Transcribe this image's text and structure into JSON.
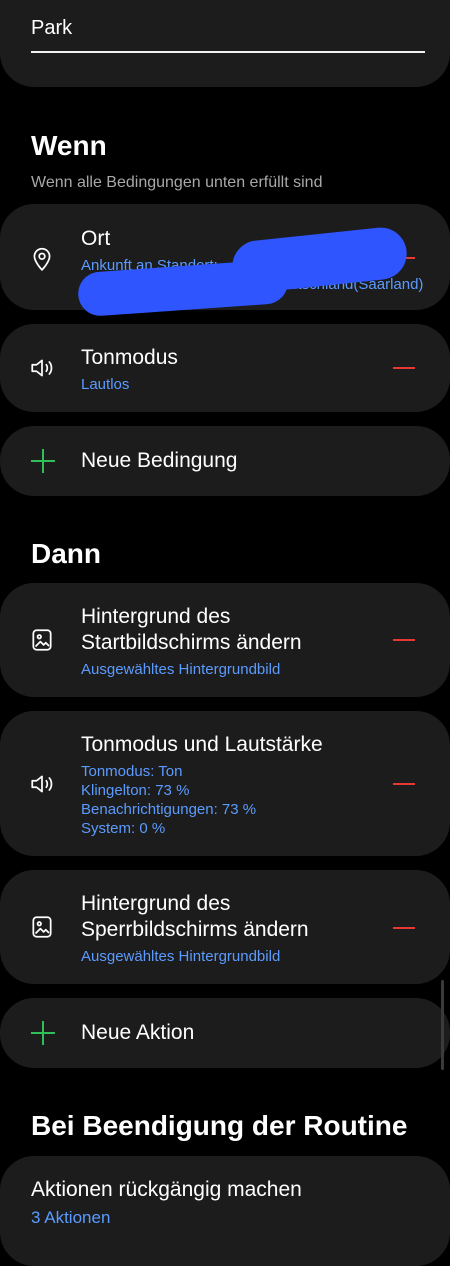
{
  "routine": {
    "name": "Park"
  },
  "when": {
    "heading": "Wenn",
    "subtitle": "Wenn alle Bedingungen unten erfüllt sind",
    "conditions": [
      {
        "icon": "location-pin-icon",
        "title": "Ort",
        "detail_1": "Ankunft an Standort:",
        "detail_2": "Deutschland(Saarland)"
      },
      {
        "icon": "speaker-icon",
        "title": "Tonmodus",
        "detail_1": "Lautlos"
      }
    ],
    "add_label": "Neue Bedingung"
  },
  "then": {
    "heading": "Dann",
    "actions": [
      {
        "icon": "image-icon",
        "title_1": "Hintergrund des",
        "title_2": "Startbildschirms ändern",
        "detail_1": "Ausgewähltes Hintergrundbild"
      },
      {
        "icon": "speaker-icon",
        "title_1": "Tonmodus und Lautstärke",
        "detail_1": "Tonmodus: Ton",
        "detail_2": "Klingelton: 73 %",
        "detail_3": "Benachrichtigungen: 73 %",
        "detail_4": "System: 0 %"
      },
      {
        "icon": "image-icon",
        "title_1": "Hintergrund des",
        "title_2": "Sperrbildschirms ändern",
        "detail_1": "Ausgewähltes Hintergrundbild"
      }
    ],
    "add_label": "Neue Aktion"
  },
  "on_end": {
    "heading": "Bei Beendigung der Routine",
    "title": "Aktionen rückgängig machen",
    "detail": "3 Aktionen"
  },
  "colors": {
    "background": "#000000",
    "card": "#1c1c1c",
    "accent_blue": "#5b9bff",
    "remove_red": "#e53935",
    "add_green": "#2fbf58"
  }
}
